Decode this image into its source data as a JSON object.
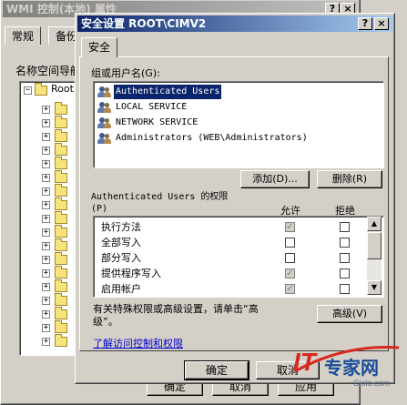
{
  "background_window": {
    "title": "WMI 控制(本地) 属性",
    "caption_buttons": [
      "?",
      "×"
    ],
    "tabs": [
      "常规",
      "备份"
    ],
    "label": "名称空间导航",
    "tree_root": "Root",
    "bottom_buttons": [
      "确定",
      "取消",
      "应用"
    ]
  },
  "dialog": {
    "title": "安全设置 ROOT\\CIMV2",
    "caption_buttons": [
      "?",
      "×"
    ],
    "tab": "安全",
    "group_label": "组或用户名(G):",
    "users": [
      {
        "name": "Authenticated Users",
        "selected": true
      },
      {
        "name": "LOCAL SERVICE",
        "selected": false
      },
      {
        "name": "NETWORK SERVICE",
        "selected": false
      },
      {
        "name": "Administrators (WEB\\Administrators)",
        "selected": false
      }
    ],
    "add_button": "添加(D)...",
    "remove_button": "删除(R)",
    "perm_label_line1": "Authenticated Users 的权限",
    "perm_label_line2": "(P)",
    "allow_header": "允许",
    "deny_header": "拒绝",
    "permissions": [
      {
        "name": "执行方法",
        "allow": true,
        "allow_disabled": true,
        "deny": false
      },
      {
        "name": "全部写入",
        "allow": false,
        "allow_disabled": false,
        "deny": false
      },
      {
        "name": "部分写入",
        "allow": false,
        "allow_disabled": false,
        "deny": false
      },
      {
        "name": "提供程序写入",
        "allow": true,
        "allow_disabled": true,
        "deny": false
      },
      {
        "name": "启用帐户",
        "allow": true,
        "allow_disabled": true,
        "deny": false
      }
    ],
    "advanced_text_line1": "有关特殊权限或高级设置，请单击“高",
    "advanced_text_line2": "级”。",
    "advanced_button": "高级(V)",
    "learn_link": "了解访问控制和权限",
    "ok_button": "确定",
    "cancel_button": "取消"
  },
  "watermark": {
    "brand_prefix": "IT",
    "brand_suffix": "专家网",
    "url": "Ciolo.com",
    "colors": {
      "red": "#d8281f",
      "blue": "#1c4d9a"
    }
  }
}
